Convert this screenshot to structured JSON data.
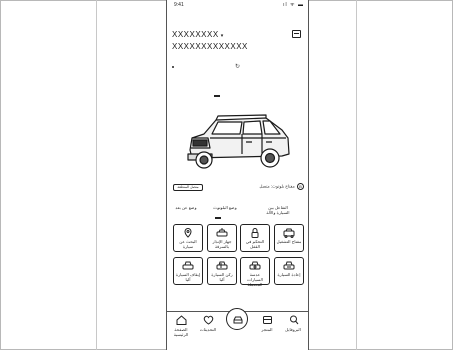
{
  "status_bar": {
    "time": "9:41",
    "indicators": "ıl ᯤ ▬"
  },
  "vehicle": {
    "name": "XXXXXXXX",
    "caret": "▾",
    "id": "XXXXXXXXXXXXX"
  },
  "refresh_glyph": "↻",
  "status_pill": "متصل المنطقة",
  "seatbelt": {
    "label": "مفتاح بلوتوث: متصل",
    "icon_glyph": "B"
  },
  "tabs": [
    {
      "label": "التفاعل بين\nالسيارة والآلة"
    },
    {
      "label": "وضع البلوتوث"
    },
    {
      "label": "وضع عن بعد"
    }
  ],
  "tiles": [
    {
      "label": "مفتاح التشغيل",
      "icon": "car-key-icon"
    },
    {
      "label": "التحكم في القفل",
      "icon": "lock-icon"
    },
    {
      "label": "جهاز الإنذار\nبالسرقة",
      "icon": "alarm-car-icon"
    },
    {
      "label": "البحث عن\nسيارة",
      "icon": "locate-car-icon"
    },
    {
      "label": "إعادة السيارة",
      "icon": "return-car-icon"
    },
    {
      "label": "عدسة السيارات\nالمحتملة",
      "icon": "camera-car-icon"
    },
    {
      "label": "ركن السيارة آليا",
      "icon": "parking-car-icon"
    },
    {
      "label": "إيقاف السيارة آليا",
      "icon": "stop-car-icon"
    }
  ],
  "bottom_nav": [
    {
      "label": "الصفحة\nالرئيسية",
      "icon": "home-icon"
    },
    {
      "label": "التحديثات",
      "icon": "heart-icon"
    },
    {
      "label": "",
      "icon": "vehicle-center-icon"
    },
    {
      "label": "المتجر",
      "icon": "store-icon"
    },
    {
      "label": "البروفايل",
      "icon": "profile-icon"
    }
  ]
}
